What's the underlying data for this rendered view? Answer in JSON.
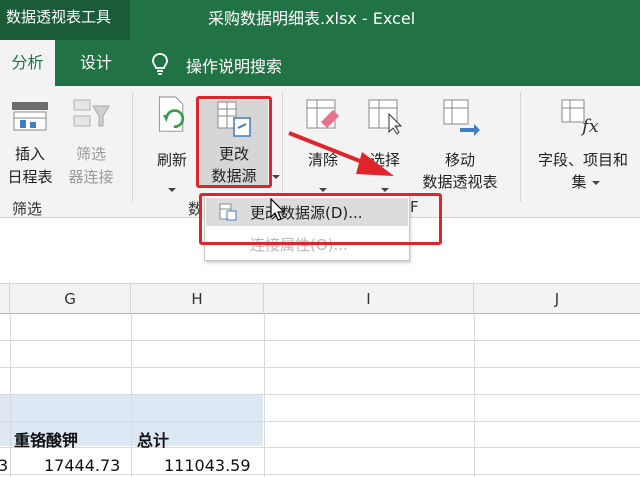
{
  "titlebar": {
    "context_tab": "数据透视表工具",
    "document_title": "采购数据明细表.xlsx  -  Excel"
  },
  "tabs": {
    "analyze": "分析",
    "design": "设计",
    "tell_me": "操作说明搜索"
  },
  "ribbon": {
    "insert_timeline": [
      "插入",
      "日程表"
    ],
    "filter_connections": [
      "筛选",
      "器连接"
    ],
    "filter_group_label": "筛选",
    "refresh": "刷新",
    "change_data_source": [
      "更改",
      "数据源"
    ],
    "data_group_label": "数",
    "clear": "清除",
    "select": "选择",
    "move_pivot": [
      "移动",
      "数据透视表"
    ],
    "fields_items": [
      "字段、项目和",
      "集"
    ],
    "actions_group_fragment": "F"
  },
  "dropdown": {
    "change_data_source": "更改数据源(D)...",
    "connection_properties": "连接属性(O)..."
  },
  "columns": [
    "G",
    "H",
    "I",
    "J"
  ],
  "pivot": {
    "headers": [
      "重铬酸钾",
      "总计"
    ],
    "values": [
      "17444.73",
      "111043.59"
    ],
    "partial_left": "3"
  },
  "colors": {
    "excel_green": "#217346",
    "annotation_red": "#e0242c",
    "pivot_header_fill": "#dce8f4"
  }
}
